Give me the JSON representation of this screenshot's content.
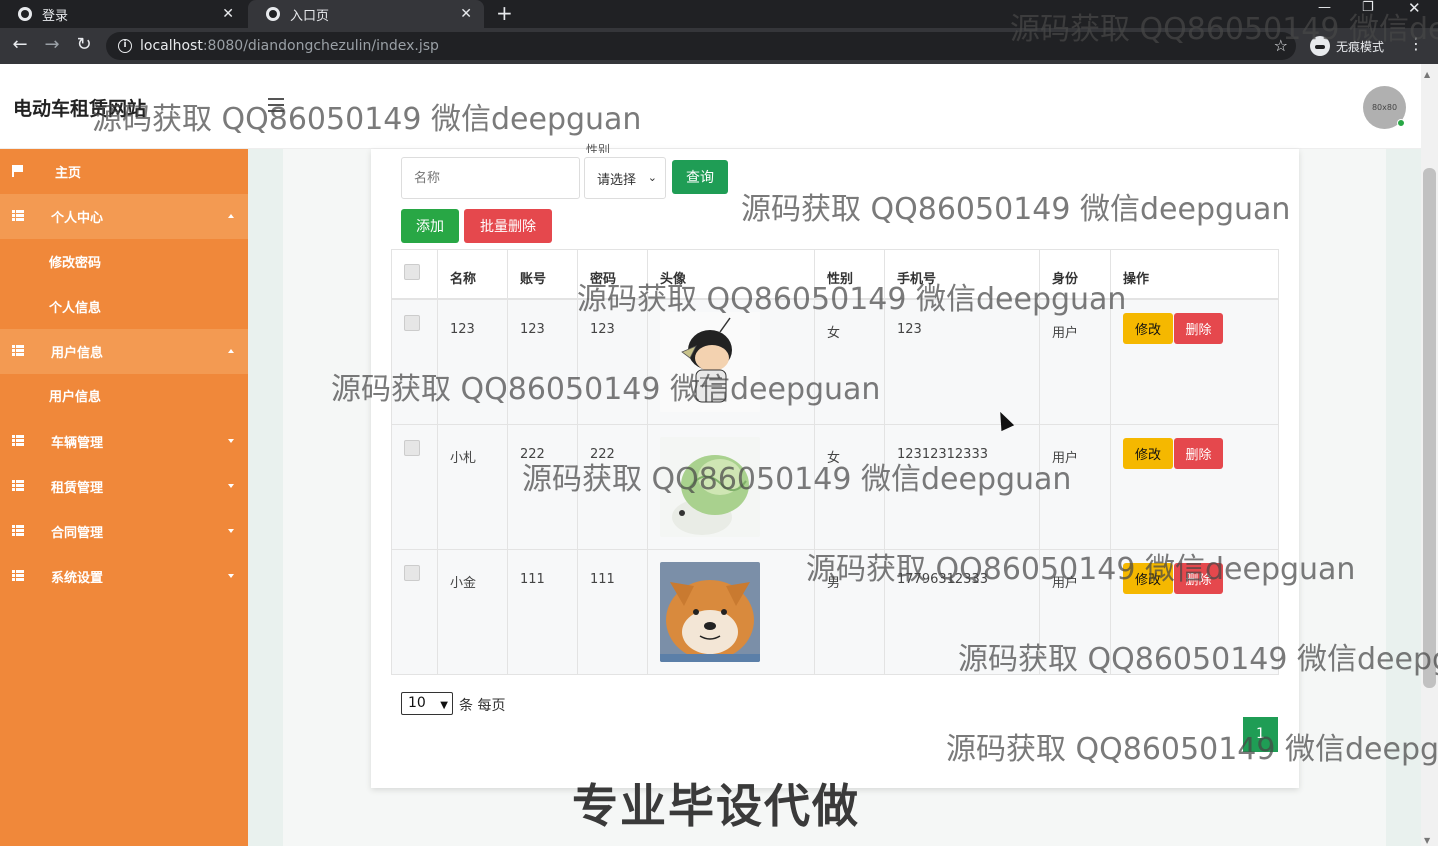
{
  "browser": {
    "tabs": [
      {
        "label": "登录",
        "active": false
      },
      {
        "label": "入口页",
        "active": true
      }
    ],
    "url_host": "localhost",
    "url_rest": ":8080/diandongchezulin/index.jsp",
    "incognito_label": "无痕模式"
  },
  "header": {
    "brand": "电动车租赁网站",
    "avatar_text": "80x80"
  },
  "sidebar": {
    "items": [
      {
        "label": "主页",
        "icon": "flag-icon",
        "type": "top"
      },
      {
        "label": "个人中心",
        "icon": "grid-icon",
        "type": "group",
        "expanded": true
      },
      {
        "label": "修改密码",
        "type": "sub"
      },
      {
        "label": "个人信息",
        "type": "sub"
      },
      {
        "label": "用户信息",
        "icon": "grid-icon",
        "type": "group",
        "expanded": true
      },
      {
        "label": "用户信息",
        "type": "sub"
      },
      {
        "label": "车辆管理",
        "icon": "grid-icon",
        "type": "top",
        "expanded": false
      },
      {
        "label": "租赁管理",
        "icon": "grid-icon",
        "type": "top",
        "expanded": false
      },
      {
        "label": "合同管理",
        "icon": "grid-icon",
        "type": "top",
        "expanded": false
      },
      {
        "label": "系统设置",
        "icon": "grid-icon",
        "type": "top",
        "expanded": false
      }
    ]
  },
  "filters": {
    "name_placeholder": "名称",
    "gender_label": "性别",
    "gender_value": "请选择",
    "query_label": "查询",
    "add_label": "添加",
    "batch_delete_label": "批量删除"
  },
  "table": {
    "headers": [
      "名称",
      "账号",
      "密码",
      "头像",
      "性别",
      "手机号",
      "身份",
      "操作"
    ],
    "rows": [
      {
        "name": "123",
        "account": "123",
        "password": "123",
        "gender": "女",
        "phone": "123",
        "role": "用户",
        "avatar": "cartoon-boy"
      },
      {
        "name": "小札",
        "account": "222",
        "password": "222",
        "gender": "女",
        "phone": "12312312333",
        "role": "用户",
        "avatar": "cabbage-creature"
      },
      {
        "name": "小金",
        "account": "111",
        "password": "111",
        "gender": "男",
        "phone": "17796312333",
        "role": "用户",
        "avatar": "shiba-dog"
      }
    ],
    "edit_label": "修改",
    "delete_label": "删除"
  },
  "pager": {
    "page_size": "10",
    "per_page_text": "条 每页",
    "current_page": "1"
  },
  "watermark": "源码获取 QQ86050149 微信deepguan",
  "promo": "专业毕设代做",
  "colors": {
    "sidebar": "#f0883a",
    "sidebar_group": "#f39a52",
    "primary_green": "#1f9d55",
    "danger": "#e5484d",
    "warning": "#f5b800"
  }
}
